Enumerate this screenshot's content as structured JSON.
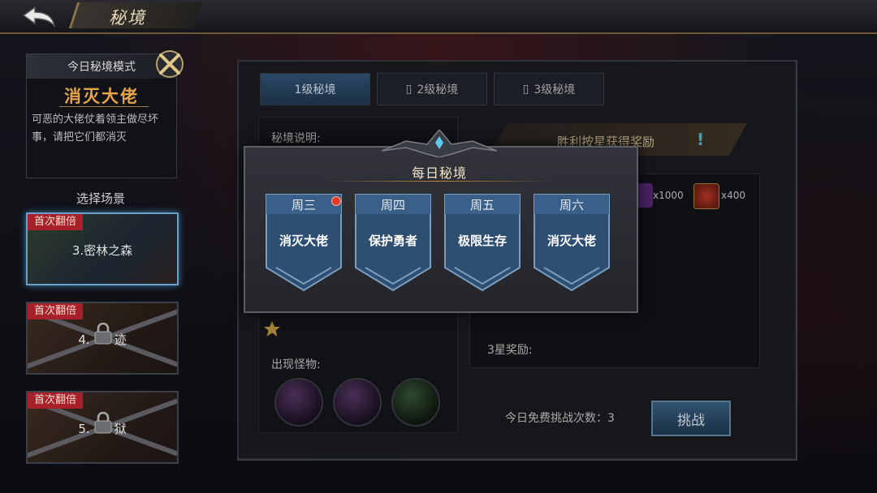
{
  "header": {
    "title": "秘境",
    "back_icon": "back-arrow-icon"
  },
  "today_mode": {
    "header": "今日秘境模式",
    "name": "消灭大佬",
    "description": "可恶的大佬仗着领主做尽坏事，请把它们都消灭"
  },
  "scene_select": {
    "title": "选择场景",
    "scenes": [
      {
        "tag": "首次翻倍",
        "name": "3.密林之森",
        "locked": false,
        "selected": true
      },
      {
        "tag": "首次翻倍",
        "name": "4.　　迹",
        "locked": true,
        "selected": false
      },
      {
        "tag": "首次翻倍",
        "name": "5.　　狱",
        "locked": true,
        "selected": false
      }
    ]
  },
  "tabs": [
    {
      "label": "1级秘境",
      "active": true
    },
    {
      "label": "2级秘境",
      "active": false,
      "icon": "lock-icon"
    },
    {
      "label": "3级秘境",
      "active": false,
      "icon": "lock-icon"
    }
  ],
  "details": {
    "description_label": "秘境说明:",
    "monster_label": "出现怪物:",
    "reward_banner": "胜利按星获得奖励",
    "rewards": [
      {
        "icon": "purple-crystal-icon",
        "qty": "x1000"
      },
      {
        "icon": "red-gem-icon",
        "qty": "x400"
      }
    ],
    "three_star_label": "3星奖励:",
    "free_attempts": "今日免费挑战次数：3",
    "challenge_label": "挑战"
  },
  "popup": {
    "title": "每日秘境",
    "days": [
      {
        "day": "周三",
        "mode": "消灭大佬",
        "has_dot": true
      },
      {
        "day": "周四",
        "mode": "保护勇者",
        "has_dot": false
      },
      {
        "day": "周五",
        "mode": "极限生存",
        "has_dot": false
      },
      {
        "day": "周六",
        "mode": "消灭大佬",
        "has_dot": false
      }
    ]
  },
  "colors": {
    "accent_gold": "#e5a44a",
    "tab_active": "#33587c",
    "tag_red": "#a8202a",
    "banner_blue": "#4a6f98",
    "excl_cyan": "#4ec7e0"
  }
}
